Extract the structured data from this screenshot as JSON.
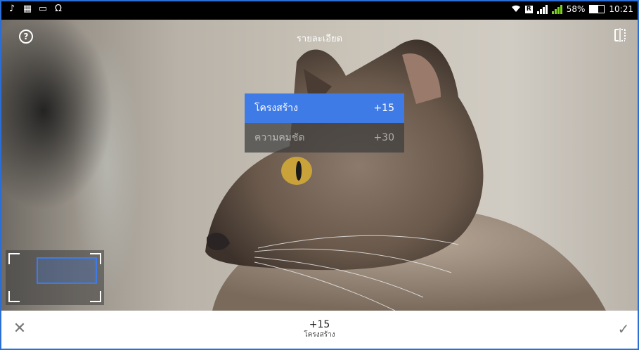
{
  "status_bar": {
    "left_icons": [
      "music-note-icon",
      "flipboard-icon",
      "image-icon",
      "headphones-icon"
    ],
    "battery_percent": "58%",
    "battery_level": 0.58,
    "time": "10:21"
  },
  "photo": {
    "title": "รายละเอียด",
    "help_icon": "?",
    "compare_icon": "compare-icon"
  },
  "menu": {
    "items": [
      {
        "label": "โครงสร้าง",
        "value": "+15",
        "selected": true
      },
      {
        "label": "ความคมชัด",
        "value": "+30",
        "selected": false
      }
    ]
  },
  "bottom": {
    "cancel_symbol": "✕",
    "apply_symbol": "✓",
    "value": "+15",
    "label": "โครงสร้าง"
  },
  "colors": {
    "accent": "#3f7be6",
    "frame": "#2b6fd6"
  }
}
